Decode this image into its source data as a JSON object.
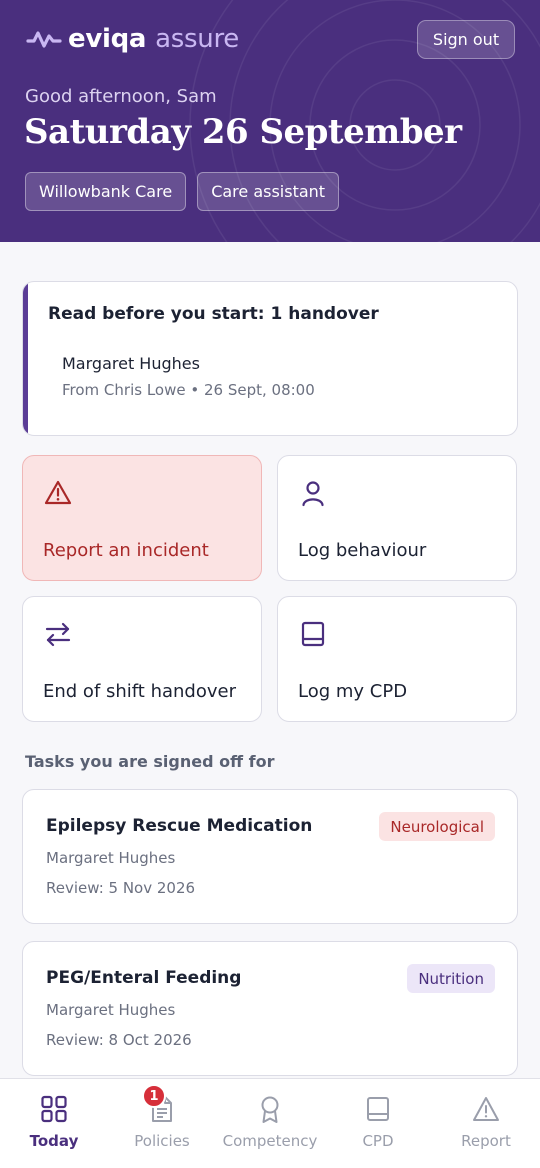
{
  "header": {
    "logo_primary": "eviqa",
    "logo_secondary": "assure",
    "sign_out_label": "Sign out",
    "greeting": "Good afternoon, Sam",
    "date": "Saturday 26 September",
    "chips": [
      "Willowbank Care",
      "Care assistant"
    ]
  },
  "handover": {
    "title": "Read before you start: 1 handover",
    "resident": "Margaret Hughes",
    "meta": "From Chris Lowe • 26 Sept, 08:00"
  },
  "actions": [
    {
      "label": "Report an incident",
      "icon": "warning-triangle-icon"
    },
    {
      "label": "Log behaviour",
      "icon": "person-icon"
    },
    {
      "label": "End of shift handover",
      "icon": "swap-arrows-icon"
    },
    {
      "label": "Log my CPD",
      "icon": "book-icon"
    }
  ],
  "tasks_section_label": "Tasks you are signed off for",
  "tasks": [
    {
      "title": "Epilepsy Rescue Medication",
      "person": "Margaret Hughes",
      "review": "Review: 5 Nov 2026",
      "tag": "Neurological"
    },
    {
      "title": "PEG/Enteral Feeding",
      "person": "Margaret Hughes",
      "review": "Review: 8 Oct 2026",
      "tag": "Nutrition"
    }
  ],
  "nav": {
    "items": [
      {
        "label": "Today",
        "icon": "grid-icon"
      },
      {
        "label": "Policies",
        "icon": "document-icon"
      },
      {
        "label": "Competency",
        "icon": "award-icon"
      },
      {
        "label": "CPD",
        "icon": "book-icon"
      },
      {
        "label": "Report",
        "icon": "warning-triangle-icon"
      }
    ],
    "active": "Today",
    "policies_badge": "1"
  },
  "colors": {
    "brand": "#4a2f7e",
    "brand_light": "#c9b7f2",
    "danger": "#a92828",
    "danger_bg": "#fbe3e3",
    "badge": "#d62f3a"
  }
}
